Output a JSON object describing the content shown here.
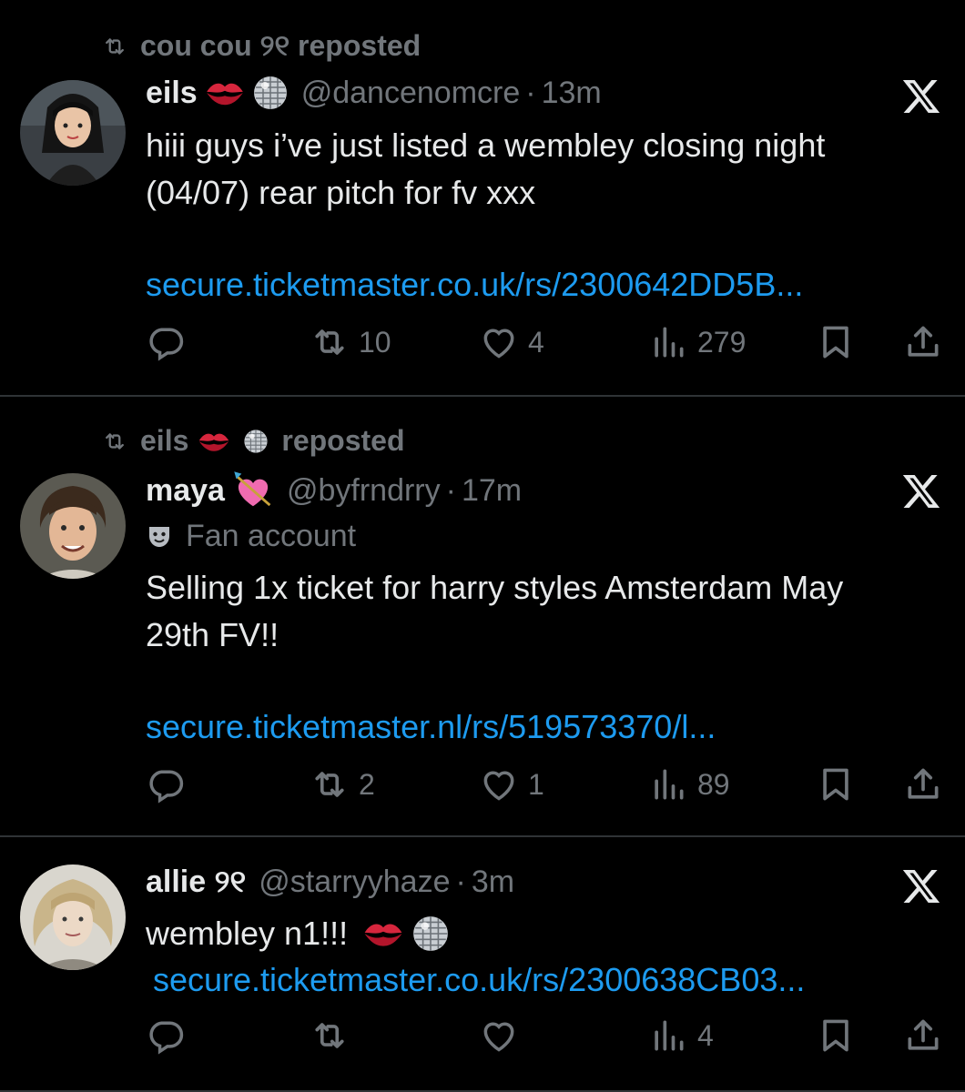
{
  "tweets": [
    {
      "repost_by": "cou cou ୨୧ reposted",
      "name": "eils",
      "handle": "@dancenomcre",
      "dot": "·",
      "time": "13m",
      "text": "hiii guys i’ve just listed a wembley closing night\n(04/07) rear pitch for fv xxx",
      "link": "secure.ticketmaster.co.uk/rs/2300642DD5B...",
      "retweets": "10",
      "likes": "4",
      "views": "279"
    },
    {
      "repost_by_name": "eils",
      "repost_suffix": "reposted",
      "name": "maya",
      "handle": "@byfrndrry",
      "dot": "·",
      "time": "17m",
      "badge": "Fan account",
      "text": "Selling 1x ticket for harry styles Amsterdam May\n29th FV!!",
      "link": "secure.ticketmaster.nl/rs/519573370/l...",
      "retweets": "2",
      "likes": "1",
      "views": "89"
    },
    {
      "name": "allie ୨୧",
      "handle": "@starryyhaze",
      "dot": "·",
      "time": "3m",
      "text": "wembley n1!!!",
      "link": "secure.ticketmaster.co.uk/rs/2300638CB03...",
      "retweets": "",
      "likes": "",
      "views": "4"
    }
  ],
  "colors": {
    "bg": "#000000",
    "text": "#e7e9ea",
    "muted": "#71767b",
    "link": "#1d9bf0",
    "divider": "#2f3336"
  },
  "icons": [
    "repost-icon",
    "close-x-icon",
    "reply-icon",
    "retweet-icon",
    "like-icon",
    "views-icon",
    "bookmark-icon",
    "share-icon",
    "kiss-emoji-icon",
    "disco-ball-emoji-icon",
    "heart-arrow-emoji-icon",
    "theater-mask-icon"
  ]
}
